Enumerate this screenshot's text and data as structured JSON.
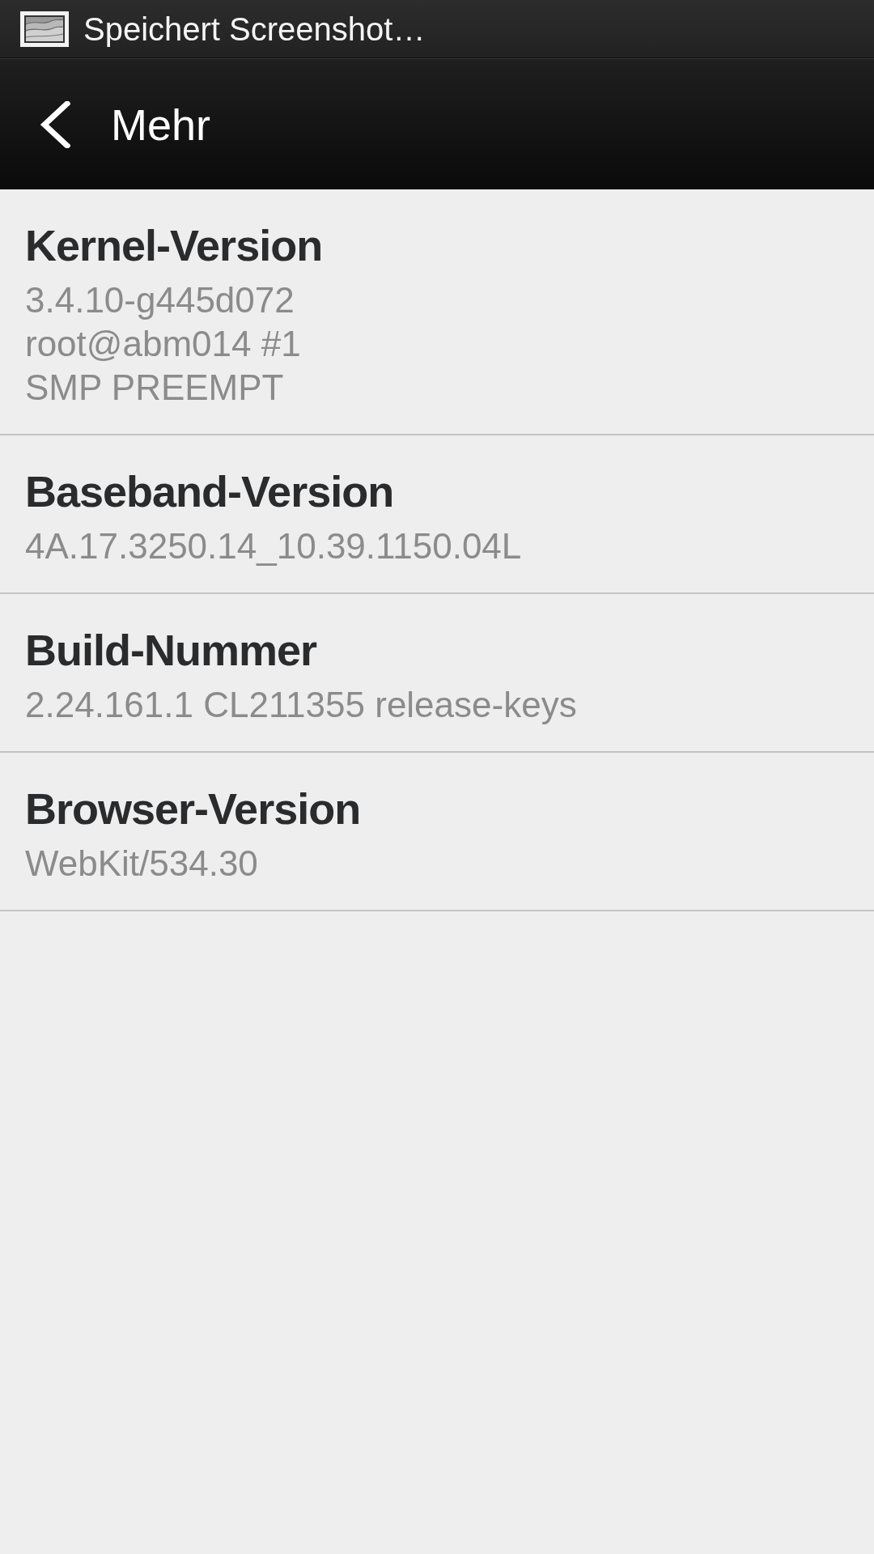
{
  "status_bar": {
    "notification": "Speichert Screenshot…"
  },
  "action_bar": {
    "title": "Mehr"
  },
  "items": [
    {
      "title": "Kernel-Version",
      "summary": "3.4.10-g445d072\nroot@abm014 #1\nSMP PREEMPT"
    },
    {
      "title": "Baseband-Version",
      "summary": "4A.17.3250.14_10.39.1150.04L"
    },
    {
      "title": "Build-Nummer",
      "summary": "2.24.161.1 CL211355 release-keys"
    },
    {
      "title": "Browser-Version",
      "summary": "WebKit/534.30"
    }
  ]
}
